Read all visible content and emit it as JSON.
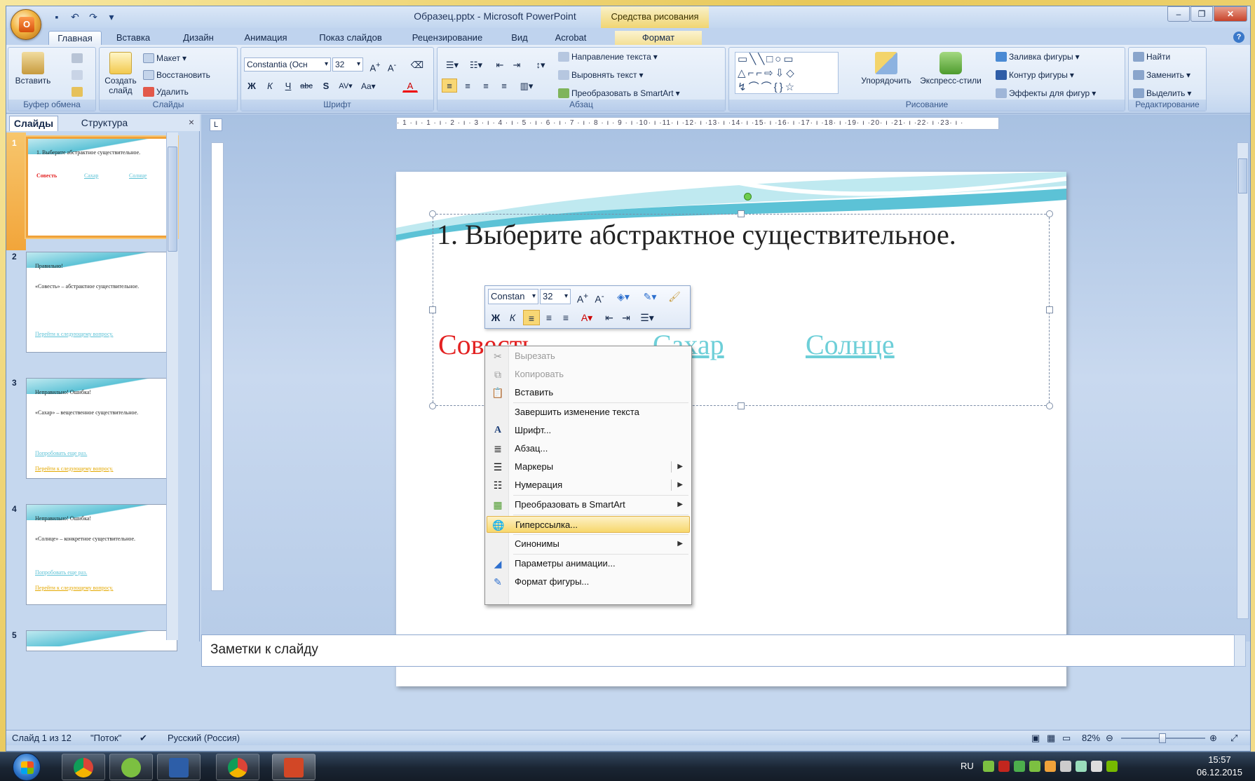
{
  "window": {
    "title": "Образец.pptx - Microsoft PowerPoint",
    "context_tab_title": "Средства рисования"
  },
  "tabs": [
    "Главная",
    "Вставка",
    "Дизайн",
    "Анимация",
    "Показ слайдов",
    "Рецензирование",
    "Вид",
    "Acrobat",
    "Формат"
  ],
  "ribbon": {
    "clipboard": {
      "paste": "Вставить",
      "label": "Буфер обмена"
    },
    "slides": {
      "new_slide_1": "Создать",
      "new_slide_2": "слайд",
      "layout": "Макет",
      "reset": "Восстановить",
      "delete": "Удалить",
      "label": "Слайды"
    },
    "font": {
      "font_name": "Constantia (Осн",
      "font_size": "32",
      "label": "Шрифт"
    },
    "paragraph": {
      "text_direction": "Направление текста",
      "align_text": "Выровнять текст",
      "convert_smartart": "Преобразовать в SmartArt",
      "label": "Абзац"
    },
    "drawing": {
      "arrange": "Упорядочить",
      "quick_styles": "Экспресс-стили",
      "shape_fill": "Заливка фигуры",
      "shape_outline": "Контур фигуры",
      "shape_effects": "Эффекты для фигур",
      "label": "Рисование"
    },
    "editing": {
      "find": "Найти",
      "replace": "Заменить",
      "select": "Выделить",
      "label": "Редактирование"
    }
  },
  "pane": {
    "tab_slides": "Слайды",
    "tab_outline": "Структура",
    "close": "×"
  },
  "thumbnails": [
    {
      "num": "1",
      "title": "1. Выберите абстрактное существительное.",
      "w1": "Совесть",
      "w2": "Сахар",
      "w3": "Солнце"
    },
    {
      "num": "2",
      "title": "Правильно!",
      "body": "«Совесть» – абстрактное существительное.",
      "link": "Перейти к следующему вопросу."
    },
    {
      "num": "3",
      "title": "Неправильно! Ошибка!",
      "body": "«Сахар» – вещественное существительное.",
      "link1": "Попробовать еще раз.",
      "link2": "Перейти к следующему вопросу."
    },
    {
      "num": "4",
      "title": "Неправильно! Ошибка!",
      "body": "«Солнце» – конкретное существительное.",
      "link1": "Попробовать еще раз.",
      "link2": "Перейти к следующему вопросу."
    },
    {
      "num": "5"
    }
  ],
  "ruler": {
    "h": "· 1 · ı · 1 · ı · 2 · ı · 3 · ı · 4 · ı · 5 · ı · 6 · ı · 7 · ı · 8 · ı · 9 · ı ·10· ı ·11· ı ·12· ı ·13· ı ·14· ı ·15· ı ·16· ı ·17· ı ·18· ı ·19· ı ·20· ı ·21· ı ·22· ı ·23· ı ·"
  },
  "slide": {
    "title": "1. Выберите абстрактное существительное.",
    "word1": "Совесть",
    "word2": "Сахар",
    "word3": "Солнце"
  },
  "mini_toolbar": {
    "font": "Constan",
    "size": "32"
  },
  "context_menu": [
    {
      "label": "Вырезать",
      "icon": "cut-icon",
      "disabled": true
    },
    {
      "label": "Копировать",
      "icon": "copy-icon",
      "disabled": true
    },
    {
      "label": "Вставить",
      "icon": "paste-icon"
    },
    {
      "label": "Завершить изменение текста"
    },
    {
      "label": "Шрифт...",
      "icon": "font-icon"
    },
    {
      "label": "Абзац...",
      "icon": "paragraph-icon"
    },
    {
      "label": "Маркеры",
      "icon": "bullets-icon",
      "submenu": true
    },
    {
      "label": "Нумерация",
      "icon": "numbering-icon",
      "submenu": true
    },
    {
      "label": "Преобразовать в SmartArt",
      "icon": "smartart-icon",
      "submenu": true
    },
    {
      "label": "Гиперссылка...",
      "icon": "hyperlink-icon",
      "highlighted": true
    },
    {
      "label": "Синонимы",
      "submenu": true
    },
    {
      "label": "Параметры анимации...",
      "icon": "animation-icon"
    },
    {
      "label": "Формат фигуры...",
      "icon": "format-shape-icon"
    }
  ],
  "notes": {
    "placeholder": "Заметки к слайду"
  },
  "status": {
    "slide": "Слайд 1 из 12",
    "theme": "\"Поток\"",
    "language": "Русский (Россия)",
    "zoom": "82%"
  },
  "taskbar": {
    "lang": "RU",
    "time": "15:57",
    "date": "06.12.2015"
  },
  "colors": {
    "accent": "#f0a23a",
    "link": "#6ecfd8",
    "red_word": "#e32222",
    "highlight": "#f7d76c"
  }
}
